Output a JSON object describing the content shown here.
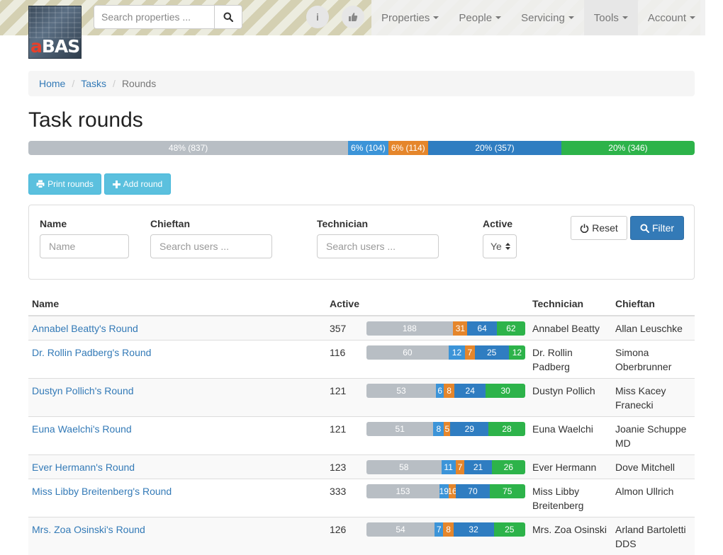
{
  "brand": {
    "logo_text_first": "a",
    "logo_text_rest": "BAS"
  },
  "search": {
    "placeholder": "Search properties ..."
  },
  "header": {
    "info_label": "i",
    "nav": [
      {
        "label": "Properties"
      },
      {
        "label": "People"
      },
      {
        "label": "Servicing"
      },
      {
        "label": "Tools"
      },
      {
        "label": "Account"
      }
    ]
  },
  "breadcrumb": {
    "items": [
      "Home",
      "Tasks"
    ],
    "current": "Rounds"
  },
  "page": {
    "title": "Task rounds"
  },
  "summary_progress": [
    {
      "label": "48% (837)",
      "percent": 48,
      "color": "#b8bec4"
    },
    {
      "label": "6% (104)",
      "percent": 6,
      "color": "#3c94d8"
    },
    {
      "label": "6% (114)",
      "percent": 6,
      "color": "#e5862b"
    },
    {
      "label": "20% (357)",
      "percent": 20,
      "color": "#2f7dc1"
    },
    {
      "label": "20% (346)",
      "percent": 20,
      "color": "#2db34a"
    }
  ],
  "actions": {
    "print_label": "Print rounds",
    "add_label": "Add round"
  },
  "filters": {
    "name_label": "Name",
    "name_placeholder": "Name",
    "chieftan_label": "Chieftan",
    "chieftan_placeholder": "Search users ...",
    "technician_label": "Technician",
    "technician_placeholder": "Search users ...",
    "active_label": "Active",
    "active_value": "Ye",
    "reset_label": "Reset",
    "filter_label": "Filter"
  },
  "table": {
    "columns": [
      "Name",
      "Active",
      "",
      "Technician",
      "Chieftan"
    ],
    "rows": [
      {
        "name": "Annabel Beatty's Round",
        "active": "357",
        "bars": [
          "188",
          "1",
          "31",
          "64",
          "62"
        ],
        "technician": "Annabel Beatty",
        "chieftan": "Allan Leuschke"
      },
      {
        "name": "Dr. Rollin Padberg's Round",
        "active": "116",
        "bars": [
          "60",
          "12",
          "7",
          "25",
          "12"
        ],
        "technician": "Dr. Rollin Padberg",
        "chieftan": "Simona Oberbrunner"
      },
      {
        "name": "Dustyn Pollich's Round",
        "active": "121",
        "bars": [
          "53",
          "6",
          "8",
          "24",
          "30"
        ],
        "technician": "Dustyn Pollich",
        "chieftan": "Miss Kacey Franecki"
      },
      {
        "name": "Euna Waelchi's Round",
        "active": "121",
        "bars": [
          "51",
          "8",
          "5",
          "29",
          "28"
        ],
        "technician": "Euna Waelchi",
        "chieftan": "Joanie Schuppe MD"
      },
      {
        "name": "Ever Hermann's Round",
        "active": "123",
        "bars": [
          "58",
          "11",
          "7",
          "21",
          "26"
        ],
        "technician": "Ever Hermann",
        "chieftan": "Dove Mitchell"
      },
      {
        "name": "Miss Libby Breitenberg's Round",
        "active": "333",
        "bars": [
          "153",
          "19",
          "16",
          "70",
          "75"
        ],
        "technician": "Miss Libby Breitenberg",
        "chieftan": "Almon Ullrich"
      },
      {
        "name": "Mrs. Zoa Osinski's Round",
        "active": "126",
        "bars": [
          "54",
          "7",
          "8",
          "32",
          "25"
        ],
        "technician": "Mrs. Zoa Osinski",
        "chieftan": "Arland Bartoletti DDS"
      }
    ]
  },
  "colors": {
    "grey": "#b8bec4",
    "light_blue": "#3c94d8",
    "orange": "#e5862b",
    "blue": "#2f7dc1",
    "green": "#2db34a",
    "link": "#337ab7"
  }
}
